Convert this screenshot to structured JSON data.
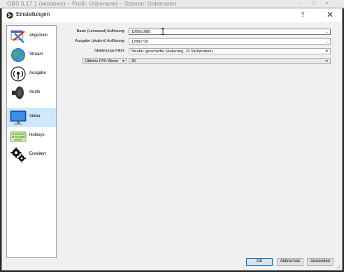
{
  "background": {
    "window_title_fragment": "OBS 0.17.1 (windows) – Profil: Unbenannt – Szenen: Unbenannt",
    "window_controls": [
      "–",
      "□",
      "×"
    ]
  },
  "dialog": {
    "title": "Einstellungen",
    "help_label": "?",
    "close_label": "✕"
  },
  "sidebar": {
    "items": [
      {
        "label": "Allgemein",
        "icon": "general-settings-icon"
      },
      {
        "label": "Stream",
        "icon": "stream-globe-icon"
      },
      {
        "label": "Ausgabe",
        "icon": "output-broadcast-icon"
      },
      {
        "label": "Audio",
        "icon": "speaker-icon"
      },
      {
        "label": "Video",
        "icon": "monitor-icon",
        "selected": true
      },
      {
        "label": "Hotkeys",
        "icon": "keyboard-icon"
      },
      {
        "label": "Erweitert",
        "icon": "gears-icon"
      }
    ]
  },
  "video": {
    "base_resolution_label": "Basis (Leinwand) Auflösung:",
    "base_resolution_value": "1920x1080",
    "output_resolution_label": "Ausgabe (skaliert) Auflösung:",
    "output_resolution_value": "1280x720",
    "scale_filter_label": "Skalierungs Filter:",
    "scale_filter_value": "Bicubic (geschärfte Skalierung, 16 Stichproben)",
    "fps_mode_value": "Übliche FPS Werte",
    "fps_value": "30"
  },
  "buttons": {
    "ok": "OK",
    "cancel": "Abbrechen",
    "apply": "Anwenden"
  },
  "colors": {
    "selection": "#cde8ff",
    "accent": "#0078d7"
  }
}
